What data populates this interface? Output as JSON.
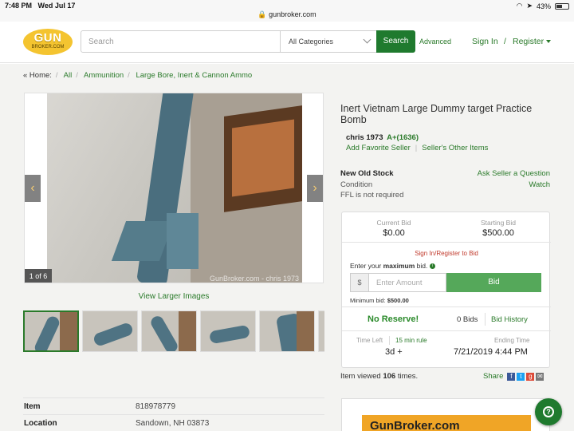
{
  "status_bar": {
    "time": "7:48 PM",
    "date": "Wed Jul 17",
    "url": "gunbroker.com",
    "battery": "43%"
  },
  "header": {
    "logo_line1": "GUN",
    "logo_line2": "BROKER.COM",
    "search_placeholder": "Search",
    "category": "All Categories",
    "search_button": "Search",
    "advanced": "Advanced",
    "sign_in": "Sign In",
    "slash": "/",
    "register": "Register"
  },
  "breadcrumb": {
    "home": "« Home:",
    "items": [
      "All",
      "Ammunition",
      "Large Bore, Inert & Cannon Ammo"
    ]
  },
  "gallery": {
    "counter": "1 of 6",
    "watermark": "GunBroker.com - chris 1973",
    "view_larger": "View Larger Images",
    "prev_arrow": "‹",
    "next_arrow": "›"
  },
  "listing": {
    "title": "Inert Vietnam Large Dummy target Practice Bomb",
    "seller_name": "chris 1973",
    "seller_rating": "A+(1636)",
    "add_favorite": "Add Favorite Seller",
    "other_items": "Seller's Other Items",
    "condition_value": "New Old Stock",
    "condition_label": "Condition",
    "ffl": "FFL is not required",
    "ask_seller": "Ask Seller a Question",
    "watch": "Watch"
  },
  "bid_box": {
    "current_bid_label": "Current Bid",
    "current_bid": "$0.00",
    "starting_bid_label": "Starting Bid",
    "starting_bid": "$500.00",
    "sign_in_register": "Sign In/Register to Bid",
    "enter_prefix": "Enter your",
    "enter_bold": "maximum",
    "enter_suffix": "bid.",
    "dollar_sign": "$",
    "amount_placeholder": "Enter Amount",
    "bid_button": "Bid",
    "min_bid_label": "Minimum bid:",
    "min_bid_value": "$500.00",
    "no_reserve": "No Reserve!",
    "bids_count": "0 Bids",
    "bid_history": "Bid History",
    "time_left_label": "Time Left",
    "rule": "15 min rule",
    "time_left_value": "3d +",
    "ending_time_label": "Ending Time",
    "ending_time_value": "7/21/2019 4:44 PM"
  },
  "viewed": {
    "prefix": "Item viewed",
    "count": "106",
    "suffix": "times."
  },
  "share": {
    "label": "Share",
    "fb": "f",
    "tw": "t",
    "gp": "g",
    "ml": "✉"
  },
  "details": [
    {
      "key": "Item",
      "value": "818978779"
    },
    {
      "key": "Location",
      "value": "Sandown, NH 03873"
    }
  ],
  "ad": {
    "text": "GunBroker.com"
  },
  "help": {
    "label": "?"
  }
}
